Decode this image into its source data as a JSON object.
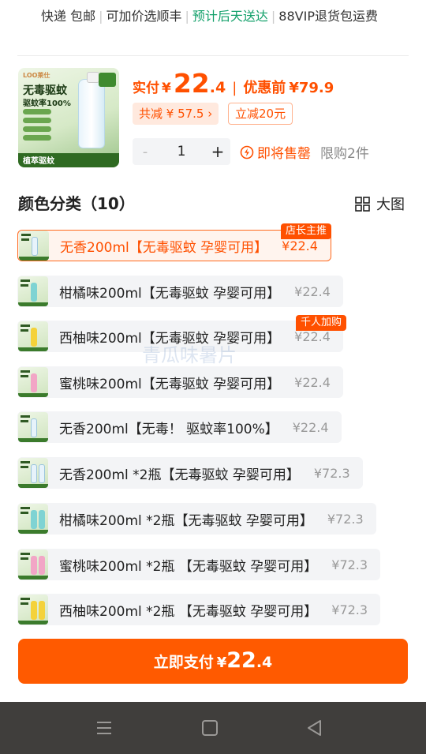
{
  "shipping": {
    "items": [
      "快递 包邮",
      "可加价选顺丰",
      "预计后天送达",
      "88VIP退货包运费"
    ]
  },
  "product": {
    "thumb": {
      "brand": "LOO莱仕",
      "title": "无毒驱蚊",
      "subtitle": "驱蚊率100%",
      "footer": "植萃驱蚊"
    },
    "price_label": "实付",
    "currency": "¥",
    "price_int": "22",
    "price_dec": ".4",
    "original_label": "优惠前",
    "original_price": "¥79.9",
    "discount_total": "共减 ¥ 57.5 ›",
    "coupon": "立减20元",
    "quantity": "1",
    "minus": "-",
    "plus": "+",
    "soon_text": "即将售罄",
    "limit_text": "限购2件"
  },
  "section": {
    "title": "颜色分类（10）",
    "bigview_label": "大图"
  },
  "variants": [
    {
      "name": "无香200ml【无毒驱蚊 孕婴可用】",
      "price": "¥22.4",
      "selected": true,
      "tag": "店长主推"
    },
    {
      "name": "柑橘味200ml【无毒驱蚊 孕婴可用】",
      "price": "¥22.4",
      "selected": false,
      "tag": ""
    },
    {
      "name": "西柚味200ml【无毒驱蚊 孕婴可用】",
      "price": "¥22.4",
      "selected": false,
      "tag": "千人加购"
    },
    {
      "name": "蜜桃味200ml【无毒驱蚊 孕婴可用】",
      "price": "¥22.4",
      "selected": false,
      "tag": ""
    },
    {
      "name": "无香200ml【无毒！ 驱蚊率100%】",
      "price": "¥22.4",
      "selected": false,
      "tag": ""
    },
    {
      "name": "无香200ml *2瓶【无毒驱蚊 孕婴可用】",
      "price": "¥72.3",
      "selected": false,
      "tag": ""
    },
    {
      "name": "柑橘味200ml *2瓶【无毒驱蚊 孕婴可用】",
      "price": "¥72.3",
      "selected": false,
      "tag": ""
    },
    {
      "name": "蜜桃味200ml *2瓶 【无毒驱蚊 孕婴可用】",
      "price": "¥72.3",
      "selected": false,
      "tag": ""
    },
    {
      "name": "西柚味200ml *2瓶 【无毒驱蚊 孕婴可用】",
      "price": "¥72.3",
      "selected": false,
      "tag": ""
    }
  ],
  "watermark": "青瓜味暑片",
  "pay": {
    "label": "立即支付",
    "currency": "¥",
    "int": "22",
    "dec": ".4"
  },
  "colors": {
    "accent": "#ff5000",
    "green": "#12a06a",
    "navbar": "#403e3c"
  }
}
